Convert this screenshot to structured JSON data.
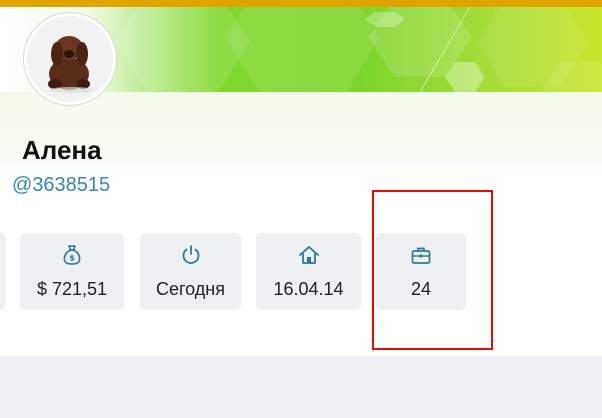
{
  "profile": {
    "name": "Алена",
    "handle": "@3638515",
    "avatar_icon": "dog-avatar-icon"
  },
  "stats": [
    {
      "id": "balance",
      "icon": "money-bag-icon",
      "value": "$ 721,51"
    },
    {
      "id": "online",
      "icon": "power-icon",
      "value": "Сегодня"
    },
    {
      "id": "registered",
      "icon": "home-icon",
      "value": "16.04.14"
    },
    {
      "id": "projects",
      "icon": "briefcase-icon",
      "value": "24"
    }
  ],
  "colors": {
    "accent_icon": "#2b7a9e",
    "handle": "#3a86b4",
    "highlight": "#e20b0b",
    "banner_green": "#7fd92b"
  }
}
